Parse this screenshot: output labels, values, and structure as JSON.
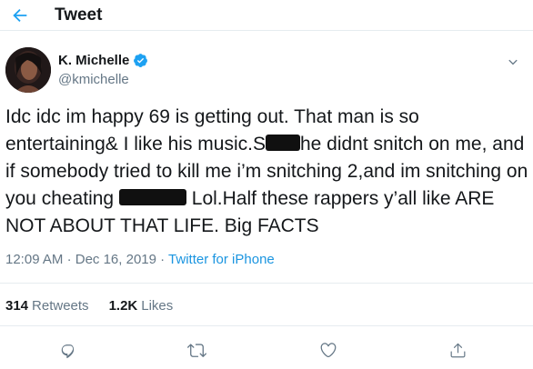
{
  "header": {
    "title": "Tweet",
    "back_icon": "arrow-left-icon"
  },
  "author": {
    "display_name": "K. Michelle",
    "handle": "@kmichelle",
    "verified": true
  },
  "tweet": {
    "text_parts": [
      "Idc idc im happy 69 is getting out. That man is so entertaining& I like his music.S",
      "he didnt snitch on me, and if somebody tried to kill me i’m snitching 2,and im snitching on you cheating ",
      " Lol.Half these rappers y’all like ARE NOT ABOUT THAT LIFE. Big FACTS"
    ],
    "time": "12:09 AM",
    "date": "Dec 16, 2019",
    "separator": "·",
    "source": "Twitter for iPhone"
  },
  "stats": {
    "retweets_count": "314",
    "retweets_label": "Retweets",
    "likes_count": "1.2K",
    "likes_label": "Likes"
  },
  "colors": {
    "accent": "#1da1f2",
    "text": "#14171a",
    "muted": "#657786",
    "border": "#e6ecf0"
  },
  "actions": [
    "reply-icon",
    "retweet-icon",
    "like-icon",
    "share-icon"
  ]
}
